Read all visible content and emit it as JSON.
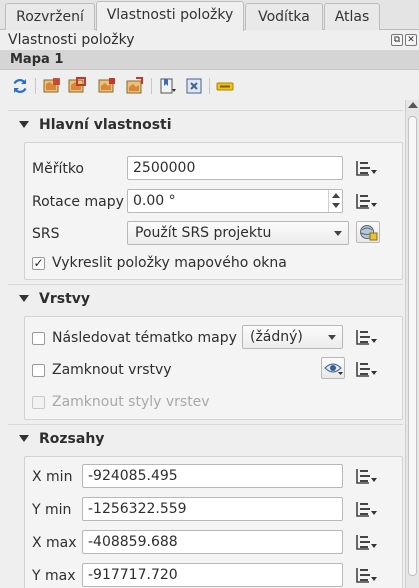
{
  "tabs": [
    {
      "label": "Rozvržení"
    },
    {
      "label": "Vlastnosti položky"
    },
    {
      "label": "Vodítka"
    },
    {
      "label": "Atlas"
    }
  ],
  "panel": {
    "title": "Vlastnosti položky",
    "float_label": "⧉",
    "close_label": "✕"
  },
  "item": {
    "title": "Mapa 1"
  },
  "toolbar": {
    "icons": [
      "refresh-icon",
      "set-extent-icon",
      "view-extent-icon",
      "set-scale-icon",
      "move-content-icon",
      "bookmarks-icon",
      "zoom-icon",
      "labels-icon"
    ]
  },
  "main_props": {
    "title": "Hlavní vlastnosti",
    "scale_label": "Měřítko",
    "scale_value": "2500000",
    "rotation_label": "Rotace mapy",
    "rotation_value": "0.00 °",
    "srs_label": "SRS",
    "srs_value": "Použít SRS projektu",
    "draw_items_label": "Vykreslit položky mapového okna",
    "draw_items_checked": "✓"
  },
  "layers": {
    "title": "Vrstvy",
    "follow_theme_label": "Následovat tématko mapy",
    "theme_value": "(žádný)",
    "lock_layers_label": "Zamknout vrstvy",
    "lock_styles_label": "Zamknout styly vrstev"
  },
  "extents": {
    "title": "Rozsahy",
    "rows": [
      {
        "label": "X min",
        "value": "-924085.495"
      },
      {
        "label": "Y min",
        "value": "-1256322.559"
      },
      {
        "label": "X max",
        "value": "-408859.688"
      },
      {
        "label": "Y max",
        "value": "-917717.720"
      }
    ]
  }
}
